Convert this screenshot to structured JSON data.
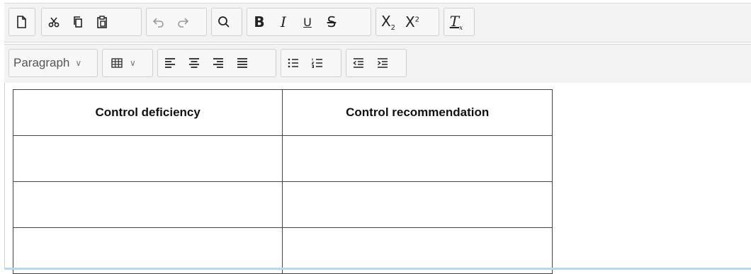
{
  "toolbar": {
    "paragraph_select": {
      "value": "Paragraph"
    },
    "subscript_label": "X",
    "subscript_suffix": "2",
    "superscript_label": "X",
    "superscript_suffix": "2",
    "bold_label": "B",
    "italic_label": "I",
    "underline_label": "U",
    "strike_label": "S",
    "clear_format_label": "T"
  },
  "table": {
    "headers": [
      "Control deficiency",
      "Control recommendation"
    ],
    "rows": [
      [
        "",
        ""
      ],
      [
        "",
        ""
      ],
      [
        "",
        ""
      ]
    ]
  }
}
